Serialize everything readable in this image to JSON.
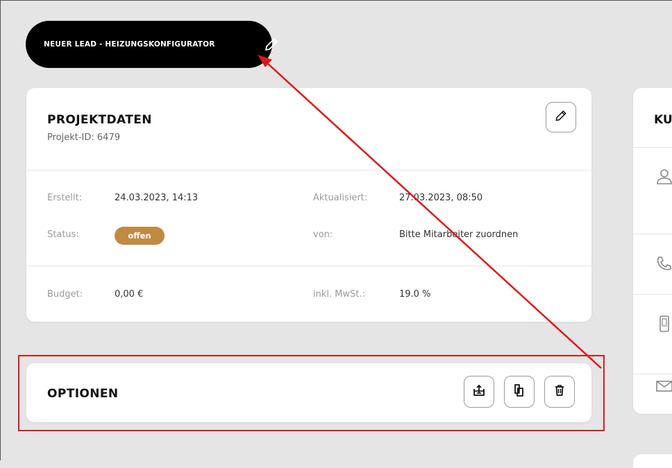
{
  "header": {
    "title": "NEUER LEAD - HEIZUNGSKONFIGURATOR",
    "edit_icon": "pencil-icon"
  },
  "projektdaten": {
    "title": "PROJEKTDATEN",
    "project_id": "Projekt-ID: 6479",
    "edit_icon": "pencil-icon",
    "fields": {
      "erstellt_label": "Erstellt:",
      "erstellt_value": "24.03.2023, 14:13",
      "aktualisiert_label": "Aktualisiert:",
      "aktualisiert_value": "27.03.2023, 08:50",
      "status_label": "Status:",
      "status_value": "offen",
      "von_label": "von:",
      "von_value": "Bitte Mitarbeiter zuordnen",
      "budget_label": "Budget:",
      "budget_value": "0,00 €",
      "mwst_label": "inkl. MwSt.:",
      "mwst_value": "19.0 %"
    }
  },
  "optionen": {
    "title": "OPTIONEN",
    "buttons": [
      "export-icon",
      "copy-icon",
      "trash-icon"
    ]
  },
  "kunde": {
    "title": "KU",
    "icons": [
      "person-icon",
      "phone-icon",
      "mobile-icon",
      "mail-icon"
    ]
  },
  "colors": {
    "background": "#e5e5e5",
    "header_pill": "#000000",
    "status_badge": "#c08a43",
    "annotation": "#e01818"
  }
}
